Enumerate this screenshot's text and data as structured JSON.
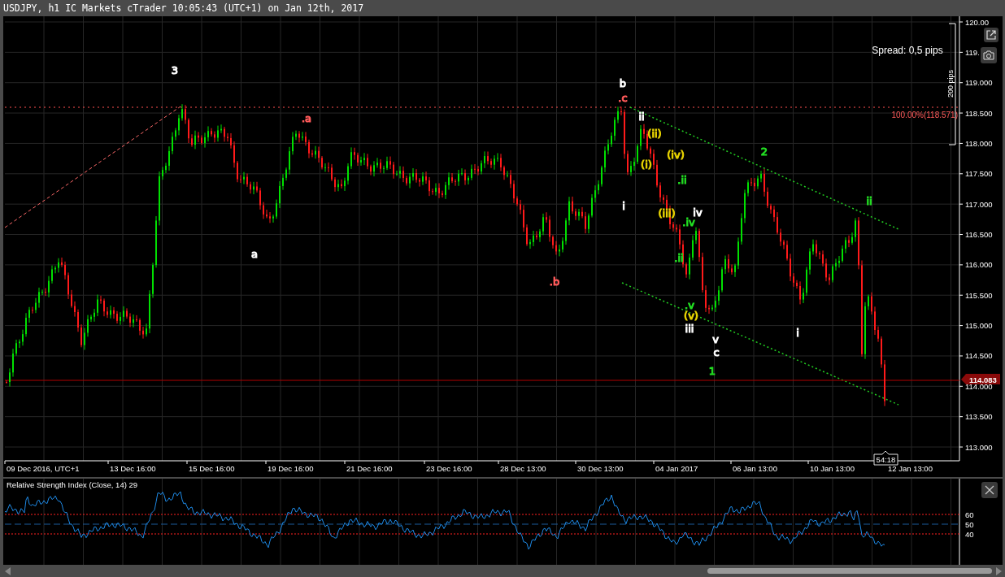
{
  "window": {
    "title": "USDJPY, h1 IC Markets cTrader 10:05:43 (UTC+1) on Jan 12th, 2017"
  },
  "chart": {
    "spread": "Spread: 0,5 pips",
    "range_label": "200 pips",
    "level_label": "100.00%(118.571)",
    "current_price": "114.083",
    "bar_timer": "54:18",
    "price_axis": [
      "120.00",
      "119.",
      "119.000",
      "118.500",
      "118.000",
      "117.500",
      "117.000",
      "116.500",
      "116.000",
      "115.500",
      "115.000",
      "114.500",
      "114.000",
      "113.500",
      "113.000"
    ],
    "time_axis": [
      "09 Dec 2016, UTC+1",
      "13 Dec 16:00",
      "15 Dec 16:00",
      "19 Dec 16:00",
      "21 Dec 16:00",
      "23 Dec 16:00",
      "28 Dec 13:00",
      "30 Dec 13:00",
      "04 Jan 2017",
      "06 Jan 13:00",
      "10 Jan 13:00",
      "12 Jan 13:00"
    ],
    "wave_labels": [
      {
        "text": "3",
        "color": "#ffffff"
      },
      {
        "text": "b",
        "color": "#ffffff"
      },
      {
        "text": ".c",
        "color": "#ff5a5a"
      },
      {
        "text": ".a",
        "color": "#ff5a5a"
      },
      {
        "text": "ii",
        "color": "#ffffff"
      },
      {
        "text": "(ii)",
        "color": "#e6d200"
      },
      {
        "text": "2",
        "color": "#22dd22"
      },
      {
        "text": "(iv)",
        "color": "#e6d200"
      },
      {
        "text": "(i)",
        "color": "#e6d200"
      },
      {
        "text": ".ii",
        "color": "#22dd22"
      },
      {
        "text": "ii",
        "color": "#22dd22"
      },
      {
        "text": "i",
        "color": "#ffffff"
      },
      {
        "text": "iv",
        "color": "#ffffff"
      },
      {
        "text": "(iii)",
        "color": "#e6d200"
      },
      {
        "text": ".iv",
        "color": "#22dd22"
      },
      {
        "text": "a",
        "color": "#ffffff"
      },
      {
        "text": ".ii",
        "color": "#22dd22"
      },
      {
        "text": ".b",
        "color": "#ff5a5a"
      },
      {
        "text": ".v",
        "color": "#22dd22"
      },
      {
        "text": "(v)",
        "color": "#e6d200"
      },
      {
        "text": "iii",
        "color": "#ffffff"
      },
      {
        "text": "i",
        "color": "#ffffff"
      },
      {
        "text": "v",
        "color": "#ffffff"
      },
      {
        "text": "c",
        "color": "#ffffff"
      },
      {
        "text": "1",
        "color": "#22dd22"
      }
    ]
  },
  "indicator": {
    "title": "Relative Strength Index (Close, 14) 29",
    "levels": [
      "60",
      "50",
      "40"
    ]
  }
}
